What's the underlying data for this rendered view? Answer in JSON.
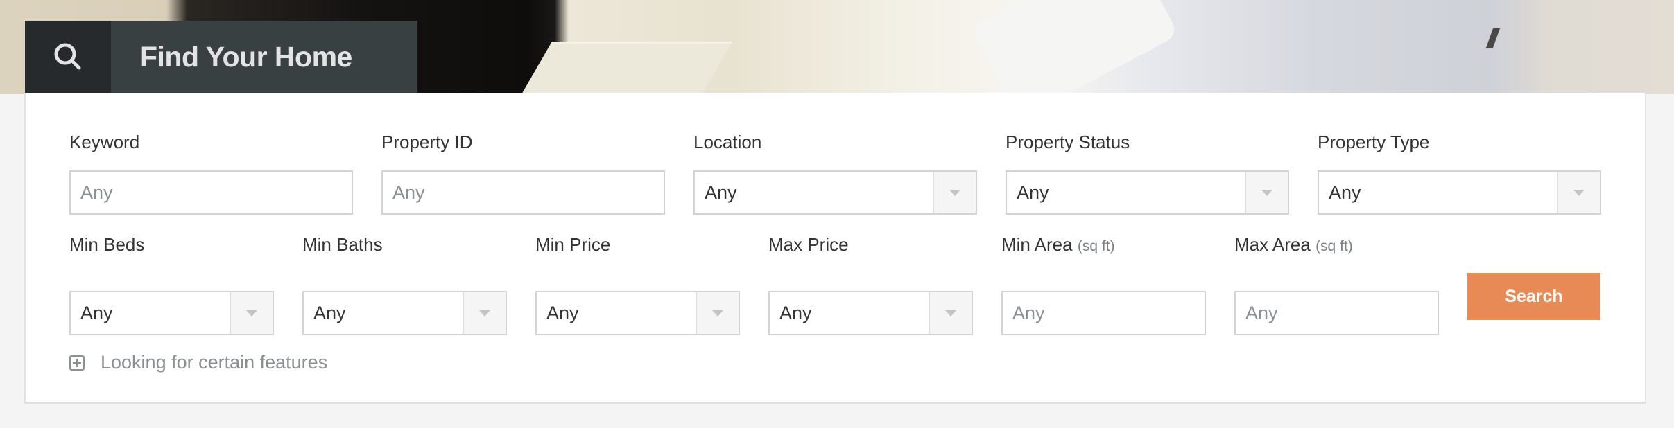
{
  "banner": {
    "icon": "search-icon",
    "title": "Find Your Home"
  },
  "colors": {
    "accent": "#e88a55",
    "banner_icon_bg": "#262a2c",
    "banner_title_bg": "#394042"
  },
  "form": {
    "row1": [
      {
        "label": "Keyword",
        "type": "text",
        "placeholder": "Any",
        "value": ""
      },
      {
        "label": "Property ID",
        "type": "text",
        "placeholder": "Any",
        "value": ""
      },
      {
        "label": "Location",
        "type": "select",
        "value": "Any"
      },
      {
        "label": "Property Status",
        "type": "select",
        "value": "Any"
      },
      {
        "label": "Property Type",
        "type": "select",
        "value": "Any"
      }
    ],
    "row2": [
      {
        "label": "Min Beds",
        "type": "select",
        "value": "Any"
      },
      {
        "label": "Min Baths",
        "type": "select",
        "value": "Any"
      },
      {
        "label": "Min Price",
        "type": "select",
        "value": "Any"
      },
      {
        "label": "Max Price",
        "type": "select",
        "value": "Any"
      },
      {
        "label": "Min Area",
        "unit": "(sq ft)",
        "type": "text",
        "placeholder": "Any",
        "value": ""
      },
      {
        "label": "Max Area",
        "unit": "(sq ft)",
        "type": "text",
        "placeholder": "Any",
        "value": ""
      }
    ],
    "search_label": "Search",
    "features_toggle": {
      "icon": "plus-square-icon",
      "label": "Looking for certain features"
    }
  }
}
